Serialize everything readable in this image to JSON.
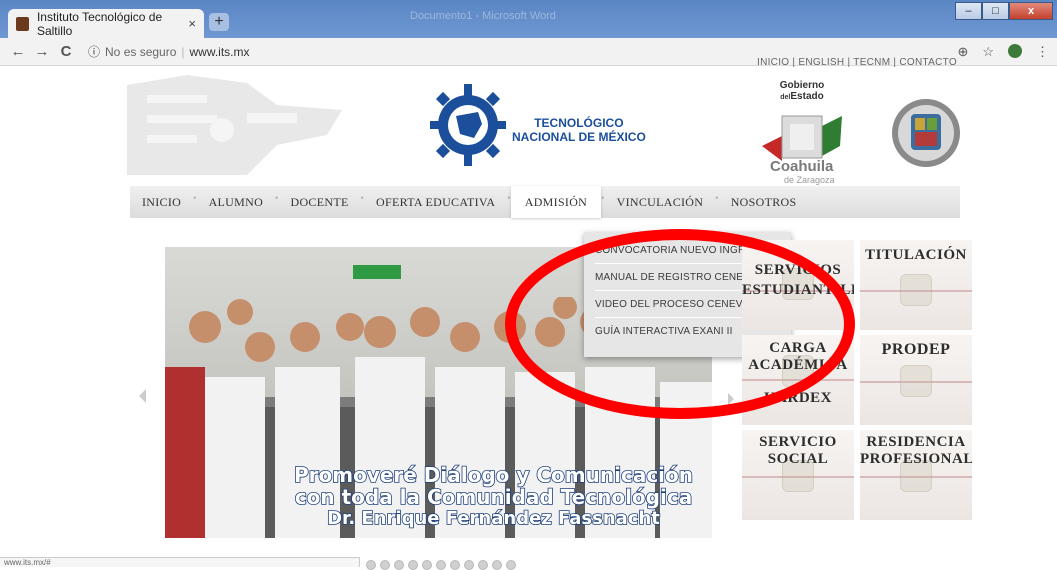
{
  "browser": {
    "tab_title": "Instituto Tecnológico de Saltillo",
    "tab_close": "×",
    "new_tab": "+",
    "background_window_title": "Documento1 - Microsoft Word",
    "window_buttons": {
      "minimize": "–",
      "maximize": "□",
      "close": "x"
    },
    "back": "←",
    "forward": "→",
    "reload": "C",
    "info_icon": "ⓘ",
    "security_label": "No es seguro",
    "separator": "|",
    "url": "www.its.mx",
    "zoom_icon": "⊕",
    "star_icon": "☆",
    "menu_icon": "⋮",
    "status_url": "www.its.mx/#"
  },
  "site": {
    "top_links": "INICIO | ENGLISH | TECNM | CONTACTO",
    "tecnm_logo": {
      "line1": "TECNOLÓGICO",
      "line2": "NACIONAL DE MÉXICO"
    },
    "gobierno": {
      "line1": "Gobierno",
      "line2_small": "del",
      "line2": "Estado",
      "name": "Coahuila",
      "sub": "de Zaragoza"
    },
    "menu": {
      "items": [
        "INICIO",
        "ALUMNO",
        "DOCENTE",
        "OFERTA EDUCATIVA",
        "ADMISIÓN",
        "VINCULACIÓN",
        "NOSOTROS"
      ],
      "separator": "•",
      "active": "ADMISIÓN"
    },
    "dropdown": [
      "CONVOCATORIA NUEVO INGRESO",
      "MANUAL DE REGISTRO CENEVAL",
      "VIDEO DEL PROCESO CENEVAL",
      "GUÍA INTERACTIVA EXANI II"
    ],
    "slider_caption": {
      "line1": "Promoveré Diálogo y Comunicación",
      "line2": "con toda la Comunidad Tecnológica",
      "line3": "Dr. Enrique Fernández Fassnacht"
    },
    "tiles": {
      "servicios": "SERVICIOS",
      "estudiantiles": "ESTUDIANTILES",
      "titulacion": "TITULACIÓN",
      "carga_1": "CARGA",
      "carga_2": "ACADÉMICA",
      "kardex": "KARDEX",
      "prodep": "PRODEP",
      "servicio_1": "SERVICIO",
      "servicio_2": "SOCIAL",
      "residencia_1": "RESIDENCIA",
      "residencia_2": "PROFESIONAL"
    },
    "slider_dots": 11
  },
  "colors": {
    "annotation_ring": "#ff0000",
    "tecnm_blue": "#1b4f9c",
    "menu_bg": "#dcdcdc"
  }
}
